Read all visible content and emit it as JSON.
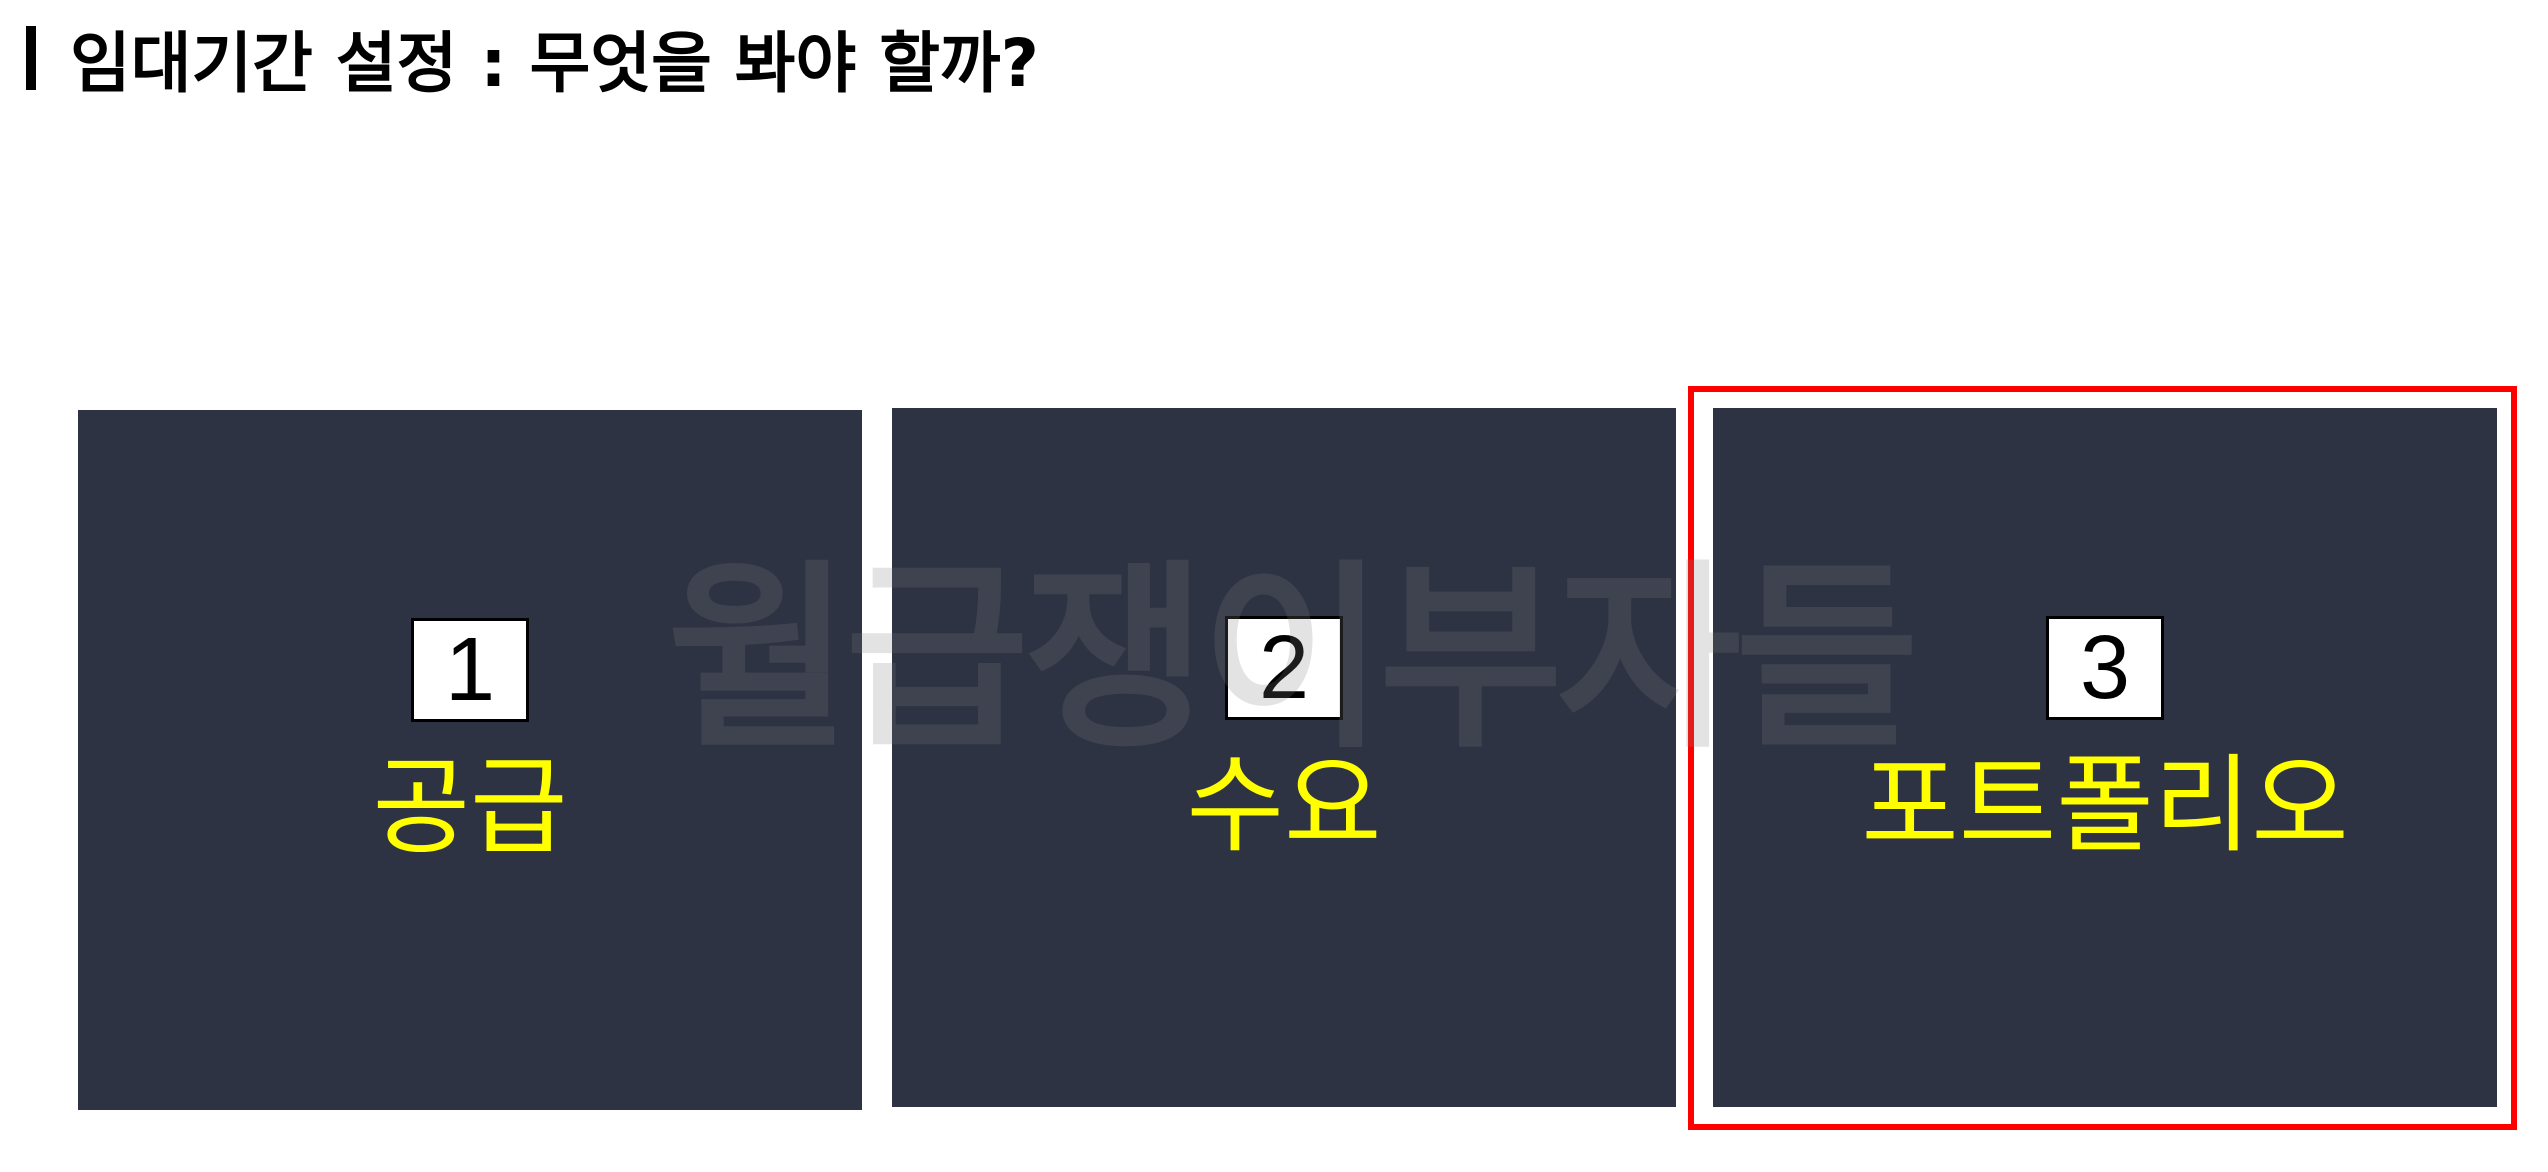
{
  "slide": {
    "title": "임대기간 설정 : 무엇을 봐야 할까?",
    "watermark": "월급쟁이부자들",
    "cards": [
      {
        "number": "1",
        "label": "공급"
      },
      {
        "number": "2",
        "label": "수요"
      },
      {
        "number": "3",
        "label": "포트폴리오"
      }
    ],
    "highlighted_card": 3
  },
  "colors": {
    "background": "#ffffff",
    "card": "#2e3343",
    "label": "#ffff00",
    "highlight_border": "#ff0000",
    "title": "#000000"
  }
}
